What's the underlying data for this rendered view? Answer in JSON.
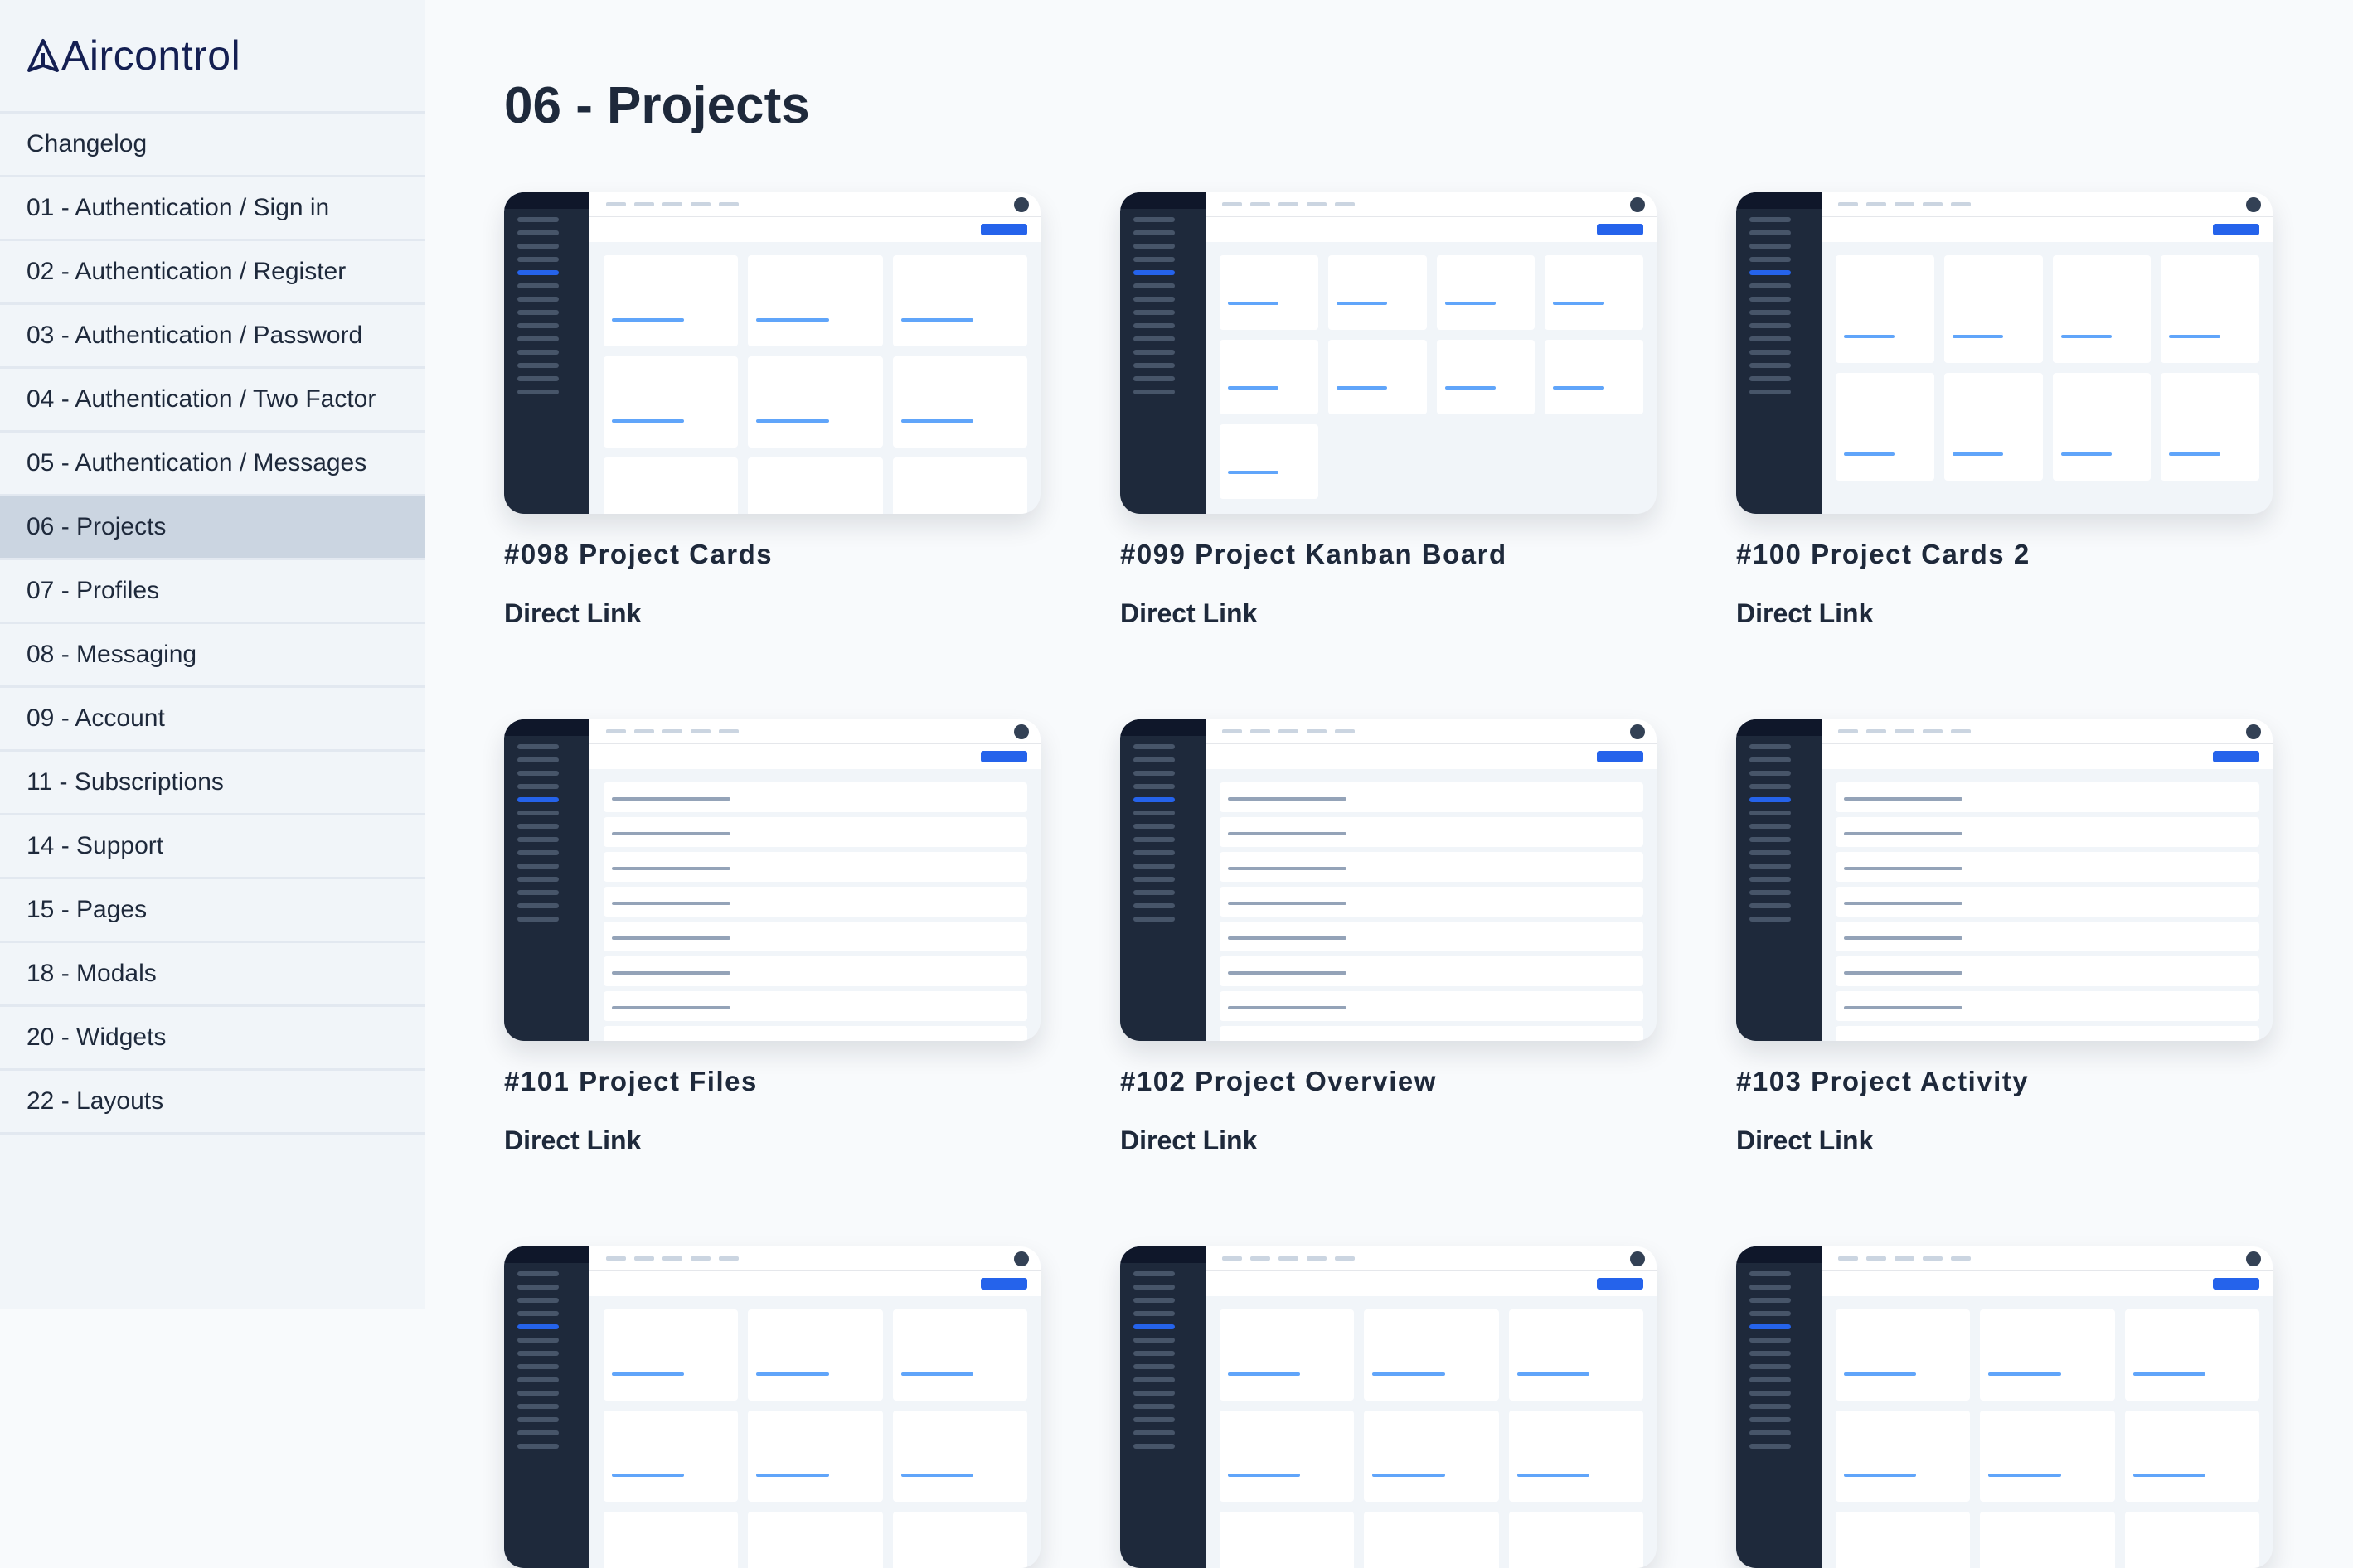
{
  "sidebar": {
    "brand": "Aircontrol",
    "items": [
      {
        "label": "Changelog"
      },
      {
        "label": "01 - Authentication / Sign in"
      },
      {
        "label": "02 - Authentication / Register"
      },
      {
        "label": "03 - Authentication / Password"
      },
      {
        "label": "04 - Authentication / Two Factor"
      },
      {
        "label": "05 - Authentication / Messages"
      },
      {
        "label": "06 - Projects",
        "active": true
      },
      {
        "label": "07 - Profiles"
      },
      {
        "label": "08 - Messaging"
      },
      {
        "label": "09 - Account"
      },
      {
        "label": "11 - Subscriptions"
      },
      {
        "label": "14 - Support"
      },
      {
        "label": "15 - Pages"
      },
      {
        "label": "18 - Modals"
      },
      {
        "label": "20 - Widgets"
      },
      {
        "label": "22 - Layouts"
      }
    ]
  },
  "main": {
    "title": "06 - Projects",
    "link_label": "Direct Link",
    "cards": [
      {
        "title": "#098 Project Cards"
      },
      {
        "title": "#099 Project Kanban Board"
      },
      {
        "title": "#100 Project Cards 2"
      },
      {
        "title": "#101 Project Files"
      },
      {
        "title": "#102 Project Overview"
      },
      {
        "title": "#103 Project Activity"
      }
    ]
  },
  "colors": {
    "sidebar_bg": "#f1f5f9",
    "active_item": "#cbd5e1",
    "text": "#1e293b",
    "brand": "#141f52",
    "thumb_sidebar": "#1e293b",
    "accent": "#2563eb"
  }
}
